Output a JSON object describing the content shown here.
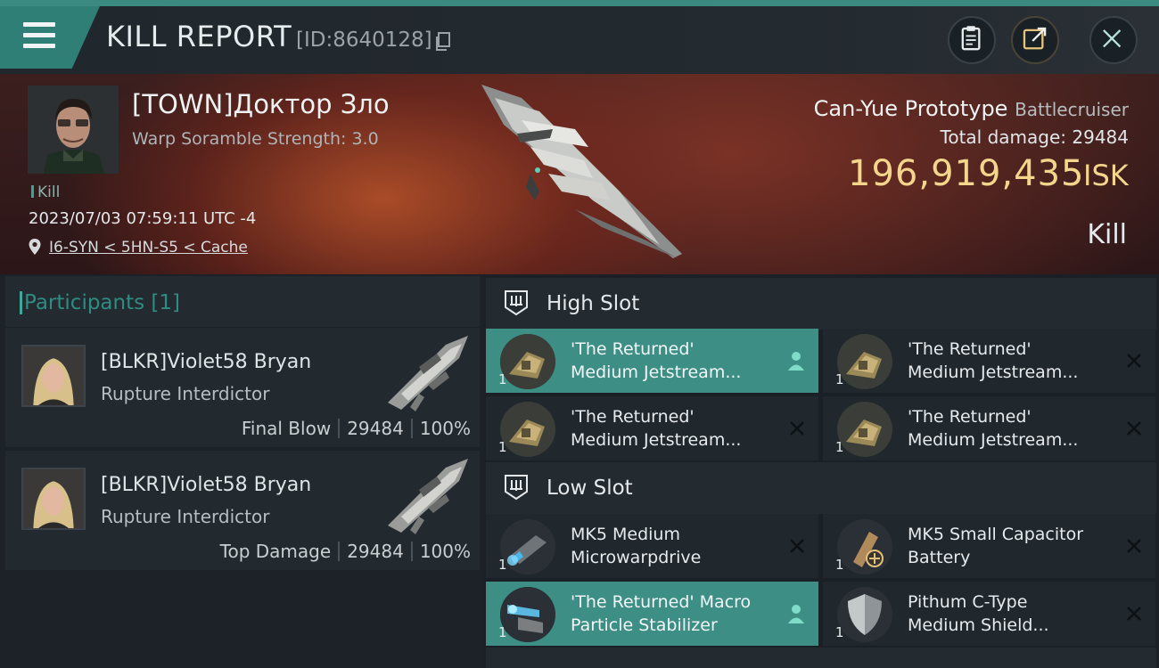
{
  "header": {
    "title": "KILL REPORT",
    "report_id": "[ID:8640128]",
    "icons": [
      "menu-icon",
      "copy-icon",
      "clipboard-icon",
      "share-icon",
      "close-icon"
    ]
  },
  "victim": {
    "pilot_name": "[TOWN]Доктор Зло",
    "warp_scramble": "Warp Soramble Strength: 3.0",
    "tag": "Kill",
    "datetime": "2023/07/03 07:59:11 UTC -4",
    "location": "I6-SYN < 5HN-S5 < Cache"
  },
  "ship": {
    "name": "Can-Yue Prototype",
    "class": "Battlecruiser",
    "total_damage_label": "Total damage:",
    "total_damage": "29484",
    "isk_value": "196,919,435",
    "isk_unit": "ISK",
    "result": "Kill"
  },
  "participants": {
    "title": "Participants [1]",
    "items": [
      {
        "name": "[BLKR]Violet58 Bryan",
        "ship": "Rupture Interdictor",
        "role": "Final Blow",
        "damage": "29484",
        "percent": "100%"
      },
      {
        "name": "[BLKR]Violet58 Bryan",
        "ship": "Rupture Interdictor",
        "role": "Top Damage",
        "damage": "29484",
        "percent": "100%"
      }
    ]
  },
  "slots": {
    "high": {
      "label": "High Slot",
      "modules": [
        {
          "line1": "'The Returned'",
          "line2": "Medium Jetstream...",
          "qty": "1",
          "active": true
        },
        {
          "line1": "'The Returned'",
          "line2": "Medium Jetstream...",
          "qty": "1",
          "active": false
        },
        {
          "line1": "'The Returned'",
          "line2": "Medium Jetstream...",
          "qty": "1",
          "active": false
        },
        {
          "line1": "'The Returned'",
          "line2": "Medium Jetstream...",
          "qty": "1",
          "active": false
        }
      ]
    },
    "low": {
      "label": "Low Slot",
      "modules": [
        {
          "line1": "MK5 Medium",
          "line2": "Microwarpdrive",
          "qty": "1",
          "active": false
        },
        {
          "line1": "MK5 Small Capacitor",
          "line2": "Battery",
          "qty": "1",
          "active": false
        },
        {
          "line1": "'The Returned' Macro",
          "line2": "Particle Stabilizer",
          "qty": "1",
          "active": true
        },
        {
          "line1": "Pithum C-Type",
          "line2": "Medium Shield...",
          "qty": "1",
          "active": false
        }
      ]
    }
  },
  "colors": {
    "accent": "#3d8f86",
    "isk": "#f3d58b",
    "background": "#1a2026"
  }
}
